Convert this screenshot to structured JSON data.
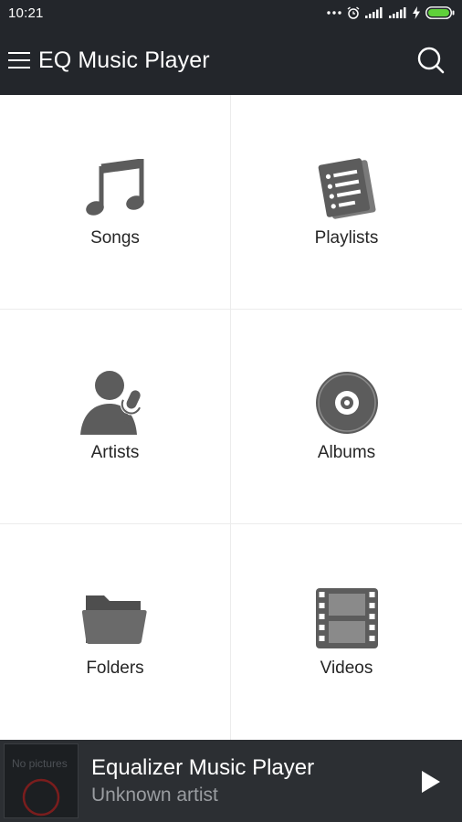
{
  "status_bar": {
    "time": "10:21",
    "icons": [
      "more-dots-icon",
      "alarm-icon",
      "signal-icon",
      "signal-icon",
      "charging-icon",
      "battery-icon"
    ]
  },
  "app_bar": {
    "title": "EQ Music Player",
    "menu_icon": "hamburger-menu-icon",
    "search_icon": "search-icon"
  },
  "categories": [
    {
      "label": "Songs",
      "icon": "music-note-icon"
    },
    {
      "label": "Playlists",
      "icon": "playlist-icon"
    },
    {
      "label": "Artists",
      "icon": "artist-microphone-icon"
    },
    {
      "label": "Albums",
      "icon": "disc-icon"
    },
    {
      "label": "Folders",
      "icon": "folder-icon"
    },
    {
      "label": "Videos",
      "icon": "film-icon"
    }
  ],
  "now_playing": {
    "artwork_text": "No pictures",
    "title": "Equalizer Music Player",
    "artist": "Unknown artist",
    "play_icon": "play-icon"
  },
  "colors": {
    "bar_bg": "#23262b",
    "player_bg": "#2c2f33",
    "icon_gray": "#5c5c5c",
    "battery_green": "#5fd13a"
  }
}
